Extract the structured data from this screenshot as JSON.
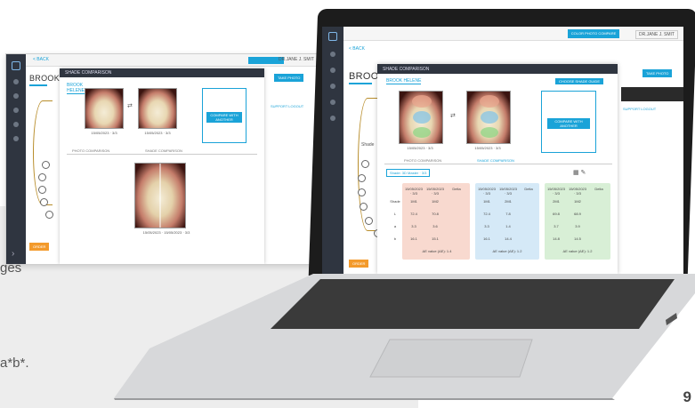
{
  "document": {
    "text_fragment_1": "ges",
    "text_fragment_2": "a*b*.",
    "page_number": "9"
  },
  "back_app": {
    "back_link": "< BACK",
    "user_label": "DR.JANE J. SMIT",
    "patient_name": "BROOK HELE",
    "modal_title": "SHADE COMPARISON",
    "modal_patient": "BROOK HELENE",
    "photo1_caption": "15/05/2023 · 3/3",
    "photo2_caption": "15/05/2023 · 3/3",
    "compare_button": "COMPARE WITH ANOTHER",
    "tab_1": "PHOTO COMPARISON",
    "tab_2": "SHADE COMPARISON",
    "photo3_caption": "15/05/2023 · 15/05/2023 · 3/3",
    "orange_button": "ORDER",
    "right_button": "TAKE PHOTO",
    "right_links": "SUPPORT   LOGOUT"
  },
  "laptop_app": {
    "back_link": "< BACK",
    "top_button": "COLOR PHOTO COMPARE",
    "user_label": "DR.JANE J. SMIT",
    "patient_name": "BROOK HELENE",
    "modal_title": "SHADE COMPARISON",
    "modal_patient": "BROOK HELENE",
    "modal_top_button": "CHOOSE SHADE GUIDE",
    "photo1_caption": "15/05/2023 · 3/3",
    "photo2_caption": "15/05/2023 · 3/3",
    "compare_button": "COMPARE WITH ANOTHER",
    "tab_1": "PHOTO COMPARISON",
    "tab_2": "SHADE COMPARISON",
    "section_label": "Shade",
    "shade_select": "Shade: 3D Master  · 3/3",
    "right_button": "TAKE PHOTO",
    "right_links": "SUPPORT   LOGOUT",
    "orange_button": "ORDER",
    "table_red": {
      "headers": [
        "15/05/2023 · 3/3",
        "15/05/2023 · 3/3",
        "Delta"
      ],
      "rows": [
        [
          "Shade",
          "1M1",
          "1M2"
        ],
        [
          "L",
          "72.4",
          "70.8"
        ],
        [
          "a",
          "3.3",
          "3.6"
        ],
        [
          "b",
          "16.1",
          "15.1"
        ]
      ],
      "footer": "ΔE value (ΔE): 1.4"
    },
    "table_blue": {
      "headers": [
        "15/05/2023 · 3/3",
        "15/05/2023 · 3/3",
        "Delta"
      ],
      "rows": [
        [
          "1M1",
          "2M1"
        ],
        [
          "72.4",
          "7.8"
        ],
        [
          "3.3",
          "1.4"
        ],
        [
          "16.1",
          "14.4"
        ]
      ],
      "footer": "ΔE value (ΔE): 1.2"
    },
    "table_green": {
      "headers": [
        "15/05/2023 · 3/3",
        "15/05/2023 · 3/3",
        "Delta"
      ],
      "rows": [
        [
          "2M1",
          "1M2"
        ],
        [
          "69.8",
          "68.9"
        ],
        [
          "3.7",
          "3.9"
        ],
        [
          "14.8",
          "14.5"
        ]
      ],
      "footer": "ΔE value (ΔE): 1.2"
    }
  },
  "colors": {
    "accent": "#1aa3d8",
    "nav_dark": "#2f3540",
    "orange": "#f39a2b",
    "red_panel": "#f8d9cf",
    "blue_panel": "#d5e9f7",
    "green_panel": "#d8efd6"
  }
}
